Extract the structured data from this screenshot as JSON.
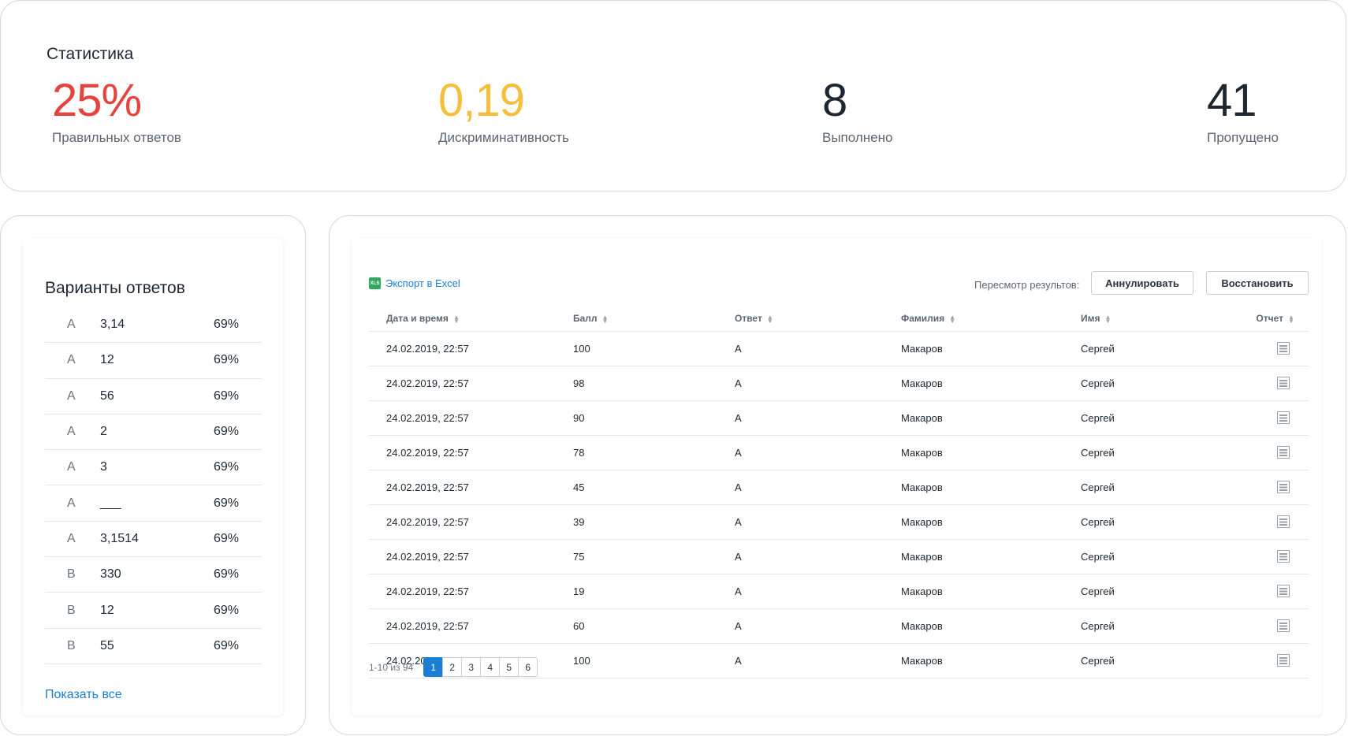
{
  "stats": {
    "title": "Статистика",
    "items": [
      {
        "value": "25%",
        "label": "Правильных ответов",
        "color": "#e8423f"
      },
      {
        "value": "0,19",
        "label": "Дискриминативность",
        "color": "#f5bf3b"
      },
      {
        "value": "8",
        "label": "Выполнено",
        "color": "#1d2733"
      },
      {
        "value": "41",
        "label": "Пропущено",
        "color": "#1d2733"
      }
    ]
  },
  "answers": {
    "title": "Варианты ответов",
    "rows": [
      {
        "letter": "А",
        "text": "3,14",
        "pct": "69%"
      },
      {
        "letter": "А",
        "text": "12",
        "pct": "69%"
      },
      {
        "letter": "А",
        "text": "56",
        "pct": "69%"
      },
      {
        "letter": "А",
        "text": "2",
        "pct": "69%"
      },
      {
        "letter": "А",
        "text": "3",
        "pct": "69%"
      },
      {
        "letter": "А",
        "text": "___",
        "pct": "69%"
      },
      {
        "letter": "А",
        "text": "3,1514",
        "pct": "69%"
      },
      {
        "letter": "В",
        "text": "330",
        "pct": "69%"
      },
      {
        "letter": "В",
        "text": "12",
        "pct": "69%"
      },
      {
        "letter": "В",
        "text": "55",
        "pct": "69%"
      }
    ],
    "show_all": "Показать все"
  },
  "results": {
    "export_label": "Экспорт в Excel",
    "export_icon": "xls-file-icon",
    "export_icon_text": "XLS",
    "review_label": "Пересмотр результов:",
    "cancel_label": "Аннулировать",
    "restore_label": "Восстановить",
    "columns": [
      "Дата и время",
      "Балл",
      "Ответ",
      "Фамилия",
      "Имя",
      "Отчет"
    ],
    "rows": [
      {
        "date": "24.02.2019, 22:57",
        "score": "100",
        "answer": "А",
        "last": "Макаров",
        "first": "Сергей"
      },
      {
        "date": "24.02.2019, 22:57",
        "score": "98",
        "answer": "А",
        "last": "Макаров",
        "first": "Сергей"
      },
      {
        "date": "24.02.2019, 22:57",
        "score": "90",
        "answer": "А",
        "last": "Макаров",
        "first": "Сергей"
      },
      {
        "date": "24.02.2019, 22:57",
        "score": "78",
        "answer": "А",
        "last": "Макаров",
        "first": "Сергей"
      },
      {
        "date": "24.02.2019, 22:57",
        "score": "45",
        "answer": "А",
        "last": "Макаров",
        "first": "Сергей"
      },
      {
        "date": "24.02.2019, 22:57",
        "score": "39",
        "answer": "А",
        "last": "Макаров",
        "first": "Сергей"
      },
      {
        "date": "24.02.2019, 22:57",
        "score": "75",
        "answer": "А",
        "last": "Макаров",
        "first": "Сергей"
      },
      {
        "date": "24.02.2019, 22:57",
        "score": "19",
        "answer": "А",
        "last": "Макаров",
        "first": "Сергей"
      },
      {
        "date": "24.02.2019, 22:57",
        "score": "60",
        "answer": "А",
        "last": "Макаров",
        "first": "Сергей"
      },
      {
        "date": "24.02.2019, 22:57",
        "score": "100",
        "answer": "А",
        "last": "Макаров",
        "first": "Сергей"
      }
    ],
    "pager": {
      "info": "1-10 из 94",
      "pages": [
        "1",
        "2",
        "3",
        "4",
        "5",
        "6"
      ],
      "current": "1"
    }
  },
  "colors": {
    "accent": "#1a7ed6",
    "border": "#d5d9de",
    "xls_green": "#2faa5c"
  }
}
